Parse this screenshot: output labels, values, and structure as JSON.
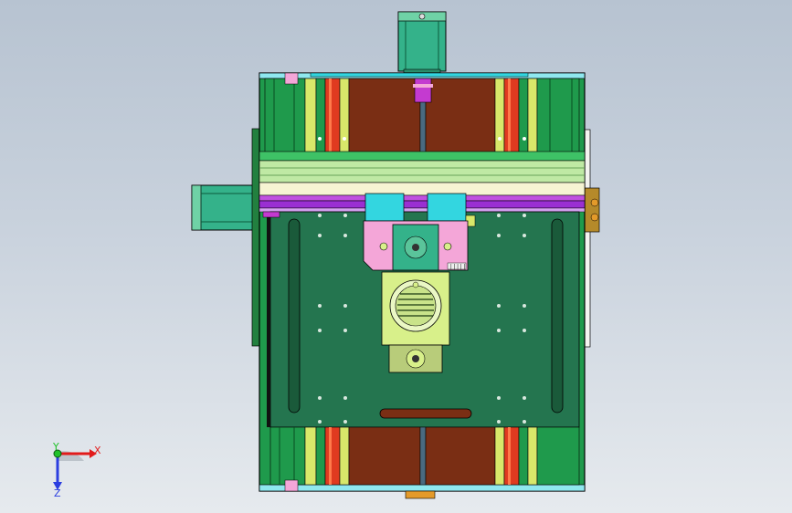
{
  "viewport": {
    "type": "3D CAD model viewport",
    "view": "top view",
    "background_colors": [
      "#b7c3d1",
      "#e6eaee"
    ]
  },
  "model": {
    "colors": {
      "frame_green": "#1f9a4c",
      "plate_green": "#24754f",
      "brown_bed": "#7a2e14",
      "rail_red": "#e03a20",
      "rail_yellow": "#d8e86a",
      "purple_rail": "#9a2fd2",
      "cyan": "#33d6e0",
      "pink": "#f4a6d8",
      "motor_teal": "#34b28a",
      "spindle_lime": "#d8f08a"
    }
  },
  "triad": {
    "x_label": "X",
    "y_label": "Y",
    "z_label": "Z",
    "x_color": "#e21b1b",
    "y_color": "#21c12b",
    "z_color": "#2b3ee0"
  }
}
